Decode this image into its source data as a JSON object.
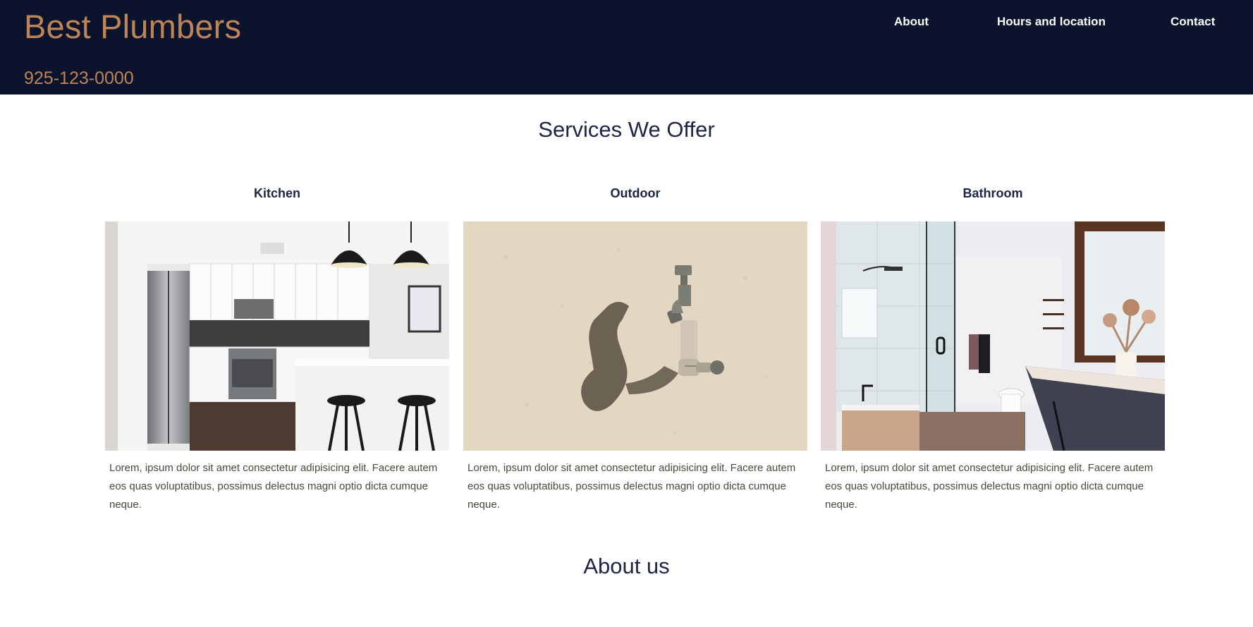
{
  "header": {
    "brand": "Best Plumbers",
    "phone": "925-123-0000",
    "nav": [
      "About",
      "Hours and location",
      "Contact"
    ]
  },
  "services": {
    "title": "Services We Offer",
    "cards": [
      {
        "title": "Kitchen",
        "text": "Lorem, ipsum dolor sit amet consectetur adipisicing elit. Facere autem eos quas voluptatibus, possimus delectus magni optio dicta cumque neque."
      },
      {
        "title": "Outdoor",
        "text": "Lorem, ipsum dolor sit amet consectetur adipisicing elit. Facere autem eos quas voluptatibus, possimus delectus magni optio dicta cumque neque."
      },
      {
        "title": "Bathroom",
        "text": "Lorem, ipsum dolor sit amet consectetur adipisicing elit. Facere autem eos quas voluptatibus, possimus delectus magni optio dicta cumque neque."
      }
    ]
  },
  "about": {
    "title": "About us"
  },
  "colors": {
    "header_bg": "#0b132d",
    "brand": "#bd8557",
    "heading": "#1c2544",
    "body_text": "#4a4a3c"
  },
  "icons": [
    "kitchen-photo",
    "outdoor-faucet-photo",
    "bathroom-photo"
  ]
}
